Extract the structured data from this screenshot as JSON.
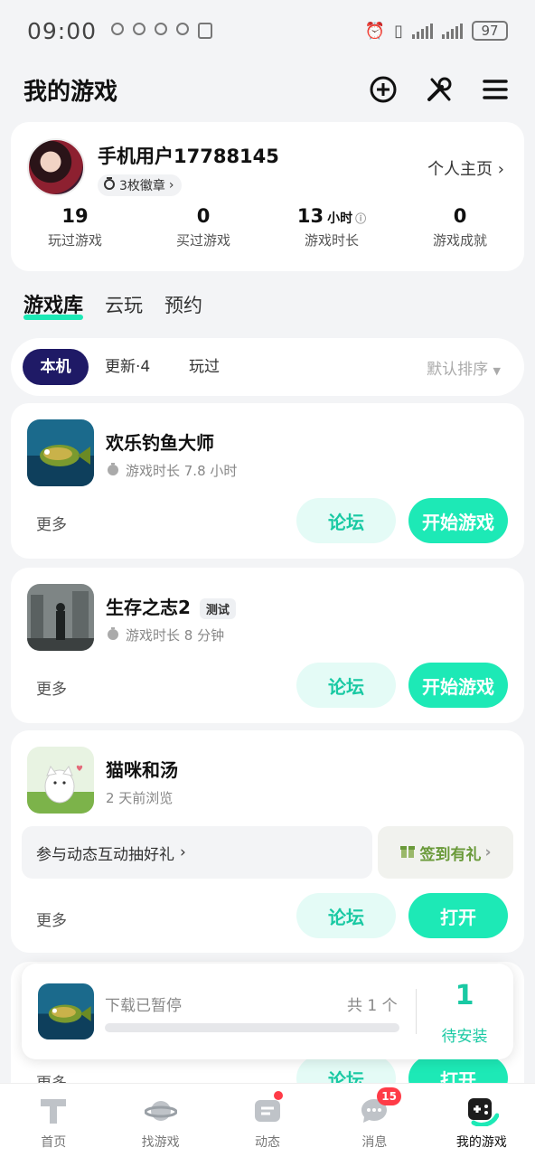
{
  "status_bar": {
    "time": "09:00",
    "battery": "97"
  },
  "header": {
    "title": "我的游戏"
  },
  "profile": {
    "username": "手机用户17788145",
    "badges": "3枚徽章",
    "profile_link": "个人主页",
    "stats": [
      {
        "value": "19",
        "label": "玩过游戏"
      },
      {
        "value": "0",
        "label": "买过游戏"
      },
      {
        "value": "13",
        "unit": "小时",
        "label": "游戏时长"
      },
      {
        "value": "0",
        "label": "游戏成就"
      }
    ]
  },
  "library_tabs": [
    "游戏库",
    "云玩",
    "预约"
  ],
  "filters": {
    "chips": [
      "本机",
      "更新·4",
      "玩过"
    ],
    "sort": "默认排序"
  },
  "games": [
    {
      "name": "欢乐钓鱼大师",
      "meta": "游戏时长 7.8 小时",
      "more": "更多",
      "forum": "论坛",
      "action": "开始游戏"
    },
    {
      "name": "生存之志2",
      "tag": "测试",
      "meta": "游戏时长 8 分钟",
      "more": "更多",
      "forum": "论坛",
      "action": "开始游戏"
    },
    {
      "name": "猫咪和汤",
      "meta": "2 天前浏览",
      "promo": "参与动态互动抽好礼",
      "checkin": "签到有礼",
      "more": "更多",
      "forum": "论坛",
      "action": "打开"
    }
  ],
  "peek_card": {
    "more": "更多",
    "forum": "论坛",
    "action": "打开"
  },
  "download": {
    "status": "下载已暂停",
    "count": "共 1 个",
    "progress": 0,
    "pending_num": "1",
    "pending_label": "待安装"
  },
  "bottom_nav": [
    {
      "label": "首页",
      "icon": "home-icon"
    },
    {
      "label": "找游戏",
      "icon": "planet-icon"
    },
    {
      "label": "动态",
      "icon": "feed-icon"
    },
    {
      "label": "消息",
      "icon": "message-icon",
      "badge": "15"
    },
    {
      "label": "我的游戏",
      "icon": "gamepad-icon"
    }
  ],
  "colors": {
    "accent": "#1de9b6",
    "accent_text": "#19c9a3",
    "chip_active": "#1f1a66",
    "badge_red": "#ff3b47"
  }
}
